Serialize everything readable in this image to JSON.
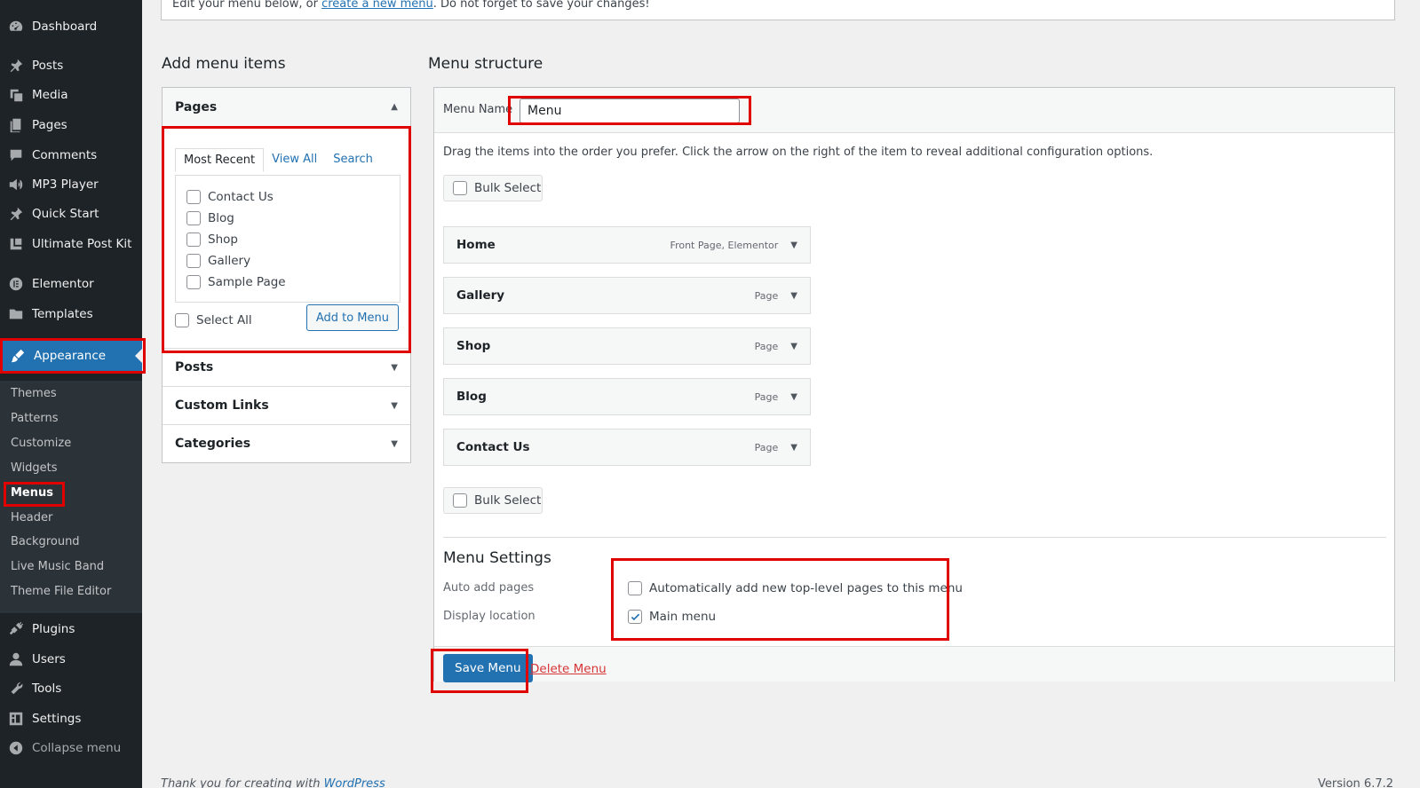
{
  "sidebar": {
    "items": [
      {
        "label": "Dashboard",
        "icon": "dashboard-icon"
      },
      {
        "label": "Posts",
        "icon": "pin-icon"
      },
      {
        "label": "Media",
        "icon": "media-icon"
      },
      {
        "label": "Pages",
        "icon": "pages-icon"
      },
      {
        "label": "Comments",
        "icon": "comment-icon"
      },
      {
        "label": "MP3 Player",
        "icon": "audio-icon"
      },
      {
        "label": "Quick Start",
        "icon": "pin-icon"
      },
      {
        "label": "Ultimate Post Kit",
        "icon": "kit-icon"
      },
      {
        "label": "Elementor",
        "icon": "elementor-icon"
      },
      {
        "label": "Templates",
        "icon": "folder-icon"
      },
      {
        "label": "Appearance",
        "icon": "brush-icon"
      },
      {
        "label": "Plugins",
        "icon": "plug-icon"
      },
      {
        "label": "Users",
        "icon": "user-icon"
      },
      {
        "label": "Tools",
        "icon": "wrench-icon"
      },
      {
        "label": "Settings",
        "icon": "settings-icon"
      }
    ],
    "submenu": [
      "Themes",
      "Patterns",
      "Customize",
      "Widgets",
      "Menus",
      "Header",
      "Background",
      "Live Music Band",
      "Theme File Editor"
    ],
    "collapse_label": "Collapse menu",
    "active_color": "#2271b1"
  },
  "notice": {
    "before": "Edit your menu below, or ",
    "link": "create a new menu",
    "after": ". Do not forget to save your changes!"
  },
  "add_items": {
    "heading": "Add menu items",
    "sections": [
      "Pages",
      "Posts",
      "Custom Links",
      "Categories"
    ],
    "tabs": [
      "Most Recent",
      "View All",
      "Search"
    ],
    "pages": [
      "Contact Us",
      "Blog",
      "Shop",
      "Gallery",
      "Sample Page"
    ],
    "select_all": "Select All",
    "add_button": "Add to Menu"
  },
  "structure": {
    "heading": "Menu structure",
    "name_label": "Menu Name",
    "name_value": "Menu",
    "instructions": "Drag the items into the order you prefer. Click the arrow on the right of the item to reveal additional configuration options.",
    "bulk_select": "Bulk Select",
    "items": [
      {
        "title": "Home",
        "type": "Front Page, Elementor"
      },
      {
        "title": "Gallery",
        "type": "Page"
      },
      {
        "title": "Shop",
        "type": "Page"
      },
      {
        "title": "Blog",
        "type": "Page"
      },
      {
        "title": "Contact Us",
        "type": "Page"
      }
    ]
  },
  "settings": {
    "heading": "Menu Settings",
    "auto_label": "Auto add pages",
    "auto_option": "Automatically add new top-level pages to this menu",
    "location_label": "Display location",
    "location_option": "Main menu",
    "location_checked": true
  },
  "actions": {
    "save": "Save Menu",
    "delete": "Delete Menu"
  },
  "footer": {
    "text": "Thank you for creating with ",
    "link": "WordPress",
    "version": "Version 6.7.2"
  },
  "highlight_color": "#e10000"
}
